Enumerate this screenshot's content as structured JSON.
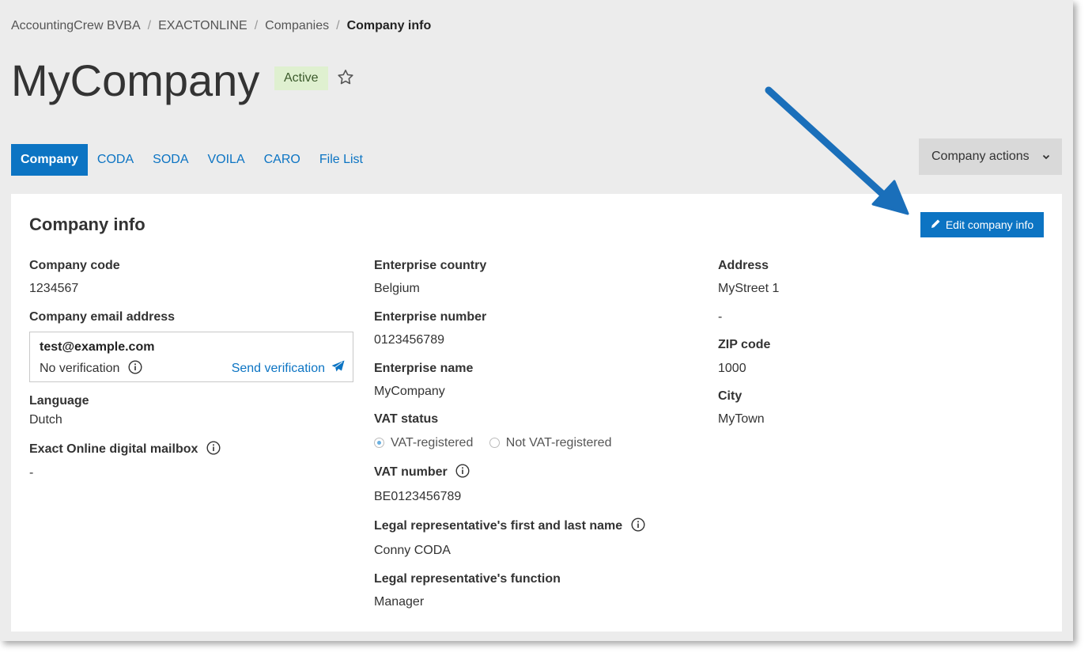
{
  "breadcrumb": {
    "items": [
      "AccountingCrew BVBA",
      "EXACTONLINE",
      "Companies"
    ],
    "current": "Company info",
    "separator": "/"
  },
  "header": {
    "title": "MyCompany",
    "status": "Active"
  },
  "tabs": [
    "Company",
    "CODA",
    "SODA",
    "VOILA",
    "CARO",
    "File List"
  ],
  "actions_label": "Company actions",
  "card": {
    "title": "Company info",
    "edit_label": "Edit company info",
    "col1": {
      "company_code_label": "Company code",
      "company_code": "1234567",
      "email_label": "Company email address",
      "email": "test@example.com",
      "verification_status": "No verification",
      "send_verification": "Send verification",
      "language_label": "Language",
      "language": "Dutch",
      "mailbox_label": "Exact Online digital mailbox",
      "mailbox": "-"
    },
    "col2": {
      "country_label": "Enterprise country",
      "country": "Belgium",
      "number_label": "Enterprise number",
      "number": "0123456789",
      "name_label": "Enterprise name",
      "name": "MyCompany",
      "vat_status_label": "VAT status",
      "vat_opt1": "VAT-registered",
      "vat_opt2": "Not VAT-registered",
      "vat_number_label": "VAT number",
      "vat_number": "BE0123456789",
      "rep_name_label": "Legal representative's first and last name",
      "rep_name": "Conny CODA",
      "rep_function_label": "Legal representative's function",
      "rep_function": "Manager"
    },
    "col3": {
      "address_label": "Address",
      "address_line1": "MyStreet 1",
      "address_line2": "-",
      "zip_label": "ZIP code",
      "zip": "1000",
      "city_label": "City",
      "city": "MyTown"
    }
  },
  "colors": {
    "accent": "#0c74c3",
    "badge_bg": "#dff0d0",
    "arrow": "#1a6fba"
  }
}
